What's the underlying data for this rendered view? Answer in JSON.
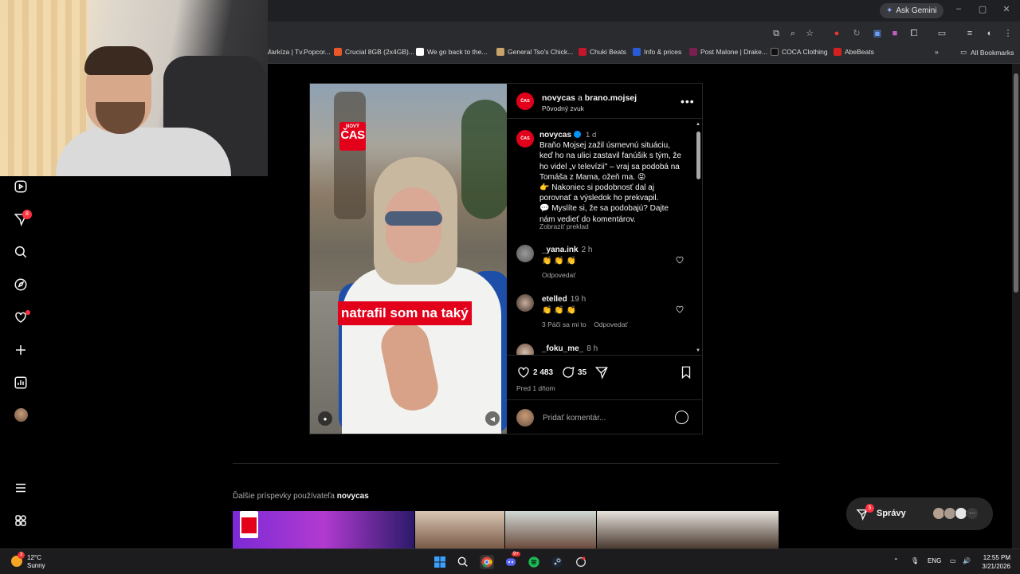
{
  "browser": {
    "ask_gemini": "Ask Gemini",
    "bookmarks": [
      {
        "label": "Markíza | Tv.Popcor...",
        "color": "#1a1a1a"
      },
      {
        "label": "Crucial 8GB (2x4GB)...",
        "color": "#e8572a"
      },
      {
        "label": "We go back to the...",
        "color": "#ffffff"
      },
      {
        "label": "General Tso's Chick...",
        "color": "#c9a46a"
      },
      {
        "label": "Chuki Beats",
        "color": "#c4162a"
      },
      {
        "label": "Info & prices",
        "color": "#2a5bd7"
      },
      {
        "label": "Post Malone | Drake...",
        "color": "#7a1f4f"
      },
      {
        "label": "COCA Clothing",
        "color": "#111111"
      },
      {
        "label": "AbeBeats",
        "color": "#d42020"
      }
    ],
    "all_bookmarks": "All Bookmarks"
  },
  "rail": {
    "notifications_badge": "8"
  },
  "post": {
    "header": {
      "author": "novycas",
      "connector": "a",
      "collab": "brano.mojsej",
      "audio": "Pôvodný zvuk",
      "more": "•••"
    },
    "video": {
      "logo_top": "NOVÝ",
      "logo_main": "ČAS",
      "caption": "natrafil som na taký"
    },
    "caption": {
      "user": "novycas",
      "time": "1 d",
      "lines": [
        "Braňo Mojsej zažil úsmevnú situáciu,",
        "keď ho na ulici zastavil fanúšik s tým, že",
        "ho videl „v televízii\" – vraj sa podobá na",
        "Tomáša z Mama, ožeň ma. 😝",
        "👉 Nakoniec si podobnosť dal aj",
        "porovnať a výsledok ho prekvapil.",
        "💬 Myslíte si, že sa podobajú? Dajte",
        "nám vedieť do komentárov."
      ],
      "translate": "Zobraziť preklad"
    },
    "comments": [
      {
        "user": "_yana.ink",
        "time": "2 h",
        "text": "👏 👏 👏",
        "meta": "Odpovedať"
      },
      {
        "user": "etelled",
        "time": "19 h",
        "text": "👏 👏 👏",
        "meta": "3 Páči sa mi to    Odpovedať"
      },
      {
        "user": "_foku_me_",
        "time": "8 h",
        "text": "",
        "meta": ""
      }
    ],
    "likes": "2 483",
    "comments_count": "35",
    "posted": "Pred 1 dňom",
    "add_comment_placeholder": "Pridať komentár..."
  },
  "more_posts": {
    "prefix": "Ďalšie príspevky používateľa",
    "user": "novycas"
  },
  "messages": {
    "label": "Správy",
    "badge": "5"
  },
  "taskbar": {
    "temp": "12°C",
    "condition": "Sunny",
    "weather_badge": "3",
    "lang": "ENG",
    "time": "12:55 PM",
    "date": "3/21/2026",
    "discord_badge": "9+"
  }
}
